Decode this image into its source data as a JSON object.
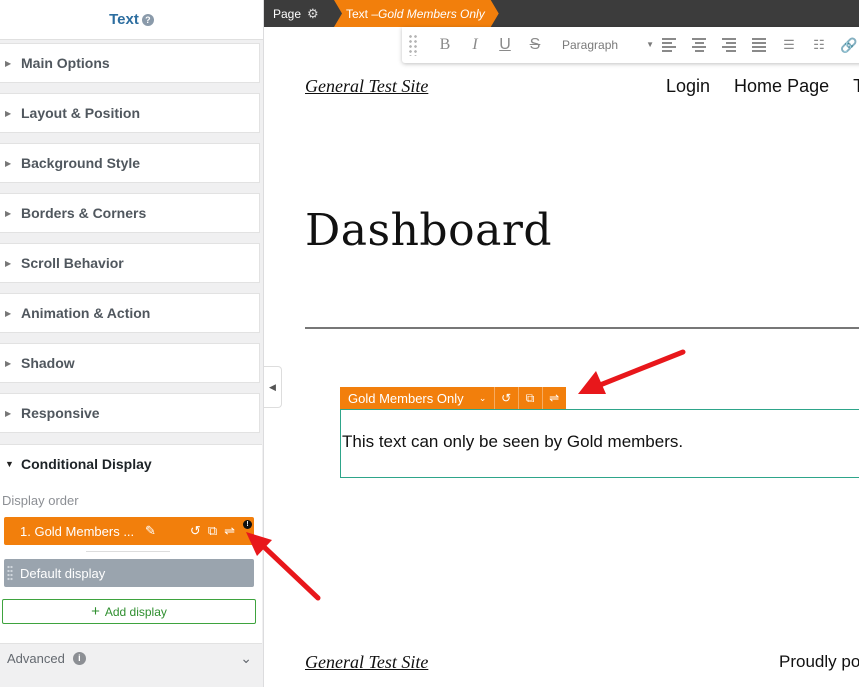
{
  "panel": {
    "title": "Text",
    "help_icon": "?",
    "sections": [
      {
        "label": "Main Options"
      },
      {
        "label": "Layout & Position"
      },
      {
        "label": "Background Style"
      },
      {
        "label": "Borders & Corners"
      },
      {
        "label": "Scroll Behavior"
      },
      {
        "label": "Animation & Action"
      },
      {
        "label": "Shadow"
      },
      {
        "label": "Responsive"
      }
    ],
    "conditional": {
      "label": "Conditional Display",
      "display_order_label": "Display order",
      "items": [
        {
          "label": "1. Gold Members ...",
          "badge": "!"
        },
        {
          "label": "Default display"
        }
      ],
      "add_label": "Add display"
    },
    "advanced_label": "Advanced",
    "advanced_info": "i"
  },
  "breadcrumb": {
    "page_label": "Page",
    "element_prefix": "Text – ",
    "element_condition": "Gold Members Only"
  },
  "toolbar": {
    "bold": "B",
    "italic": "I",
    "underline": "U",
    "strike": "S",
    "paragraph": "Paragraph"
  },
  "site": {
    "title": "General Test Site",
    "nav": [
      "Login",
      "Home Page",
      "Te"
    ],
    "heading": "Dashboard",
    "element_label": "Gold Members Only",
    "element_text": "This text can only be seen by Gold members.",
    "footer_title": "General Test Site",
    "footer_credit": "Proudly po"
  },
  "colors": {
    "accent_orange": "#f27f0c",
    "panel_title_blue": "#2d6ea0",
    "add_button_green": "#3ea33e",
    "element_border_teal": "#2ea58a",
    "annotation_red": "#e8171b"
  }
}
